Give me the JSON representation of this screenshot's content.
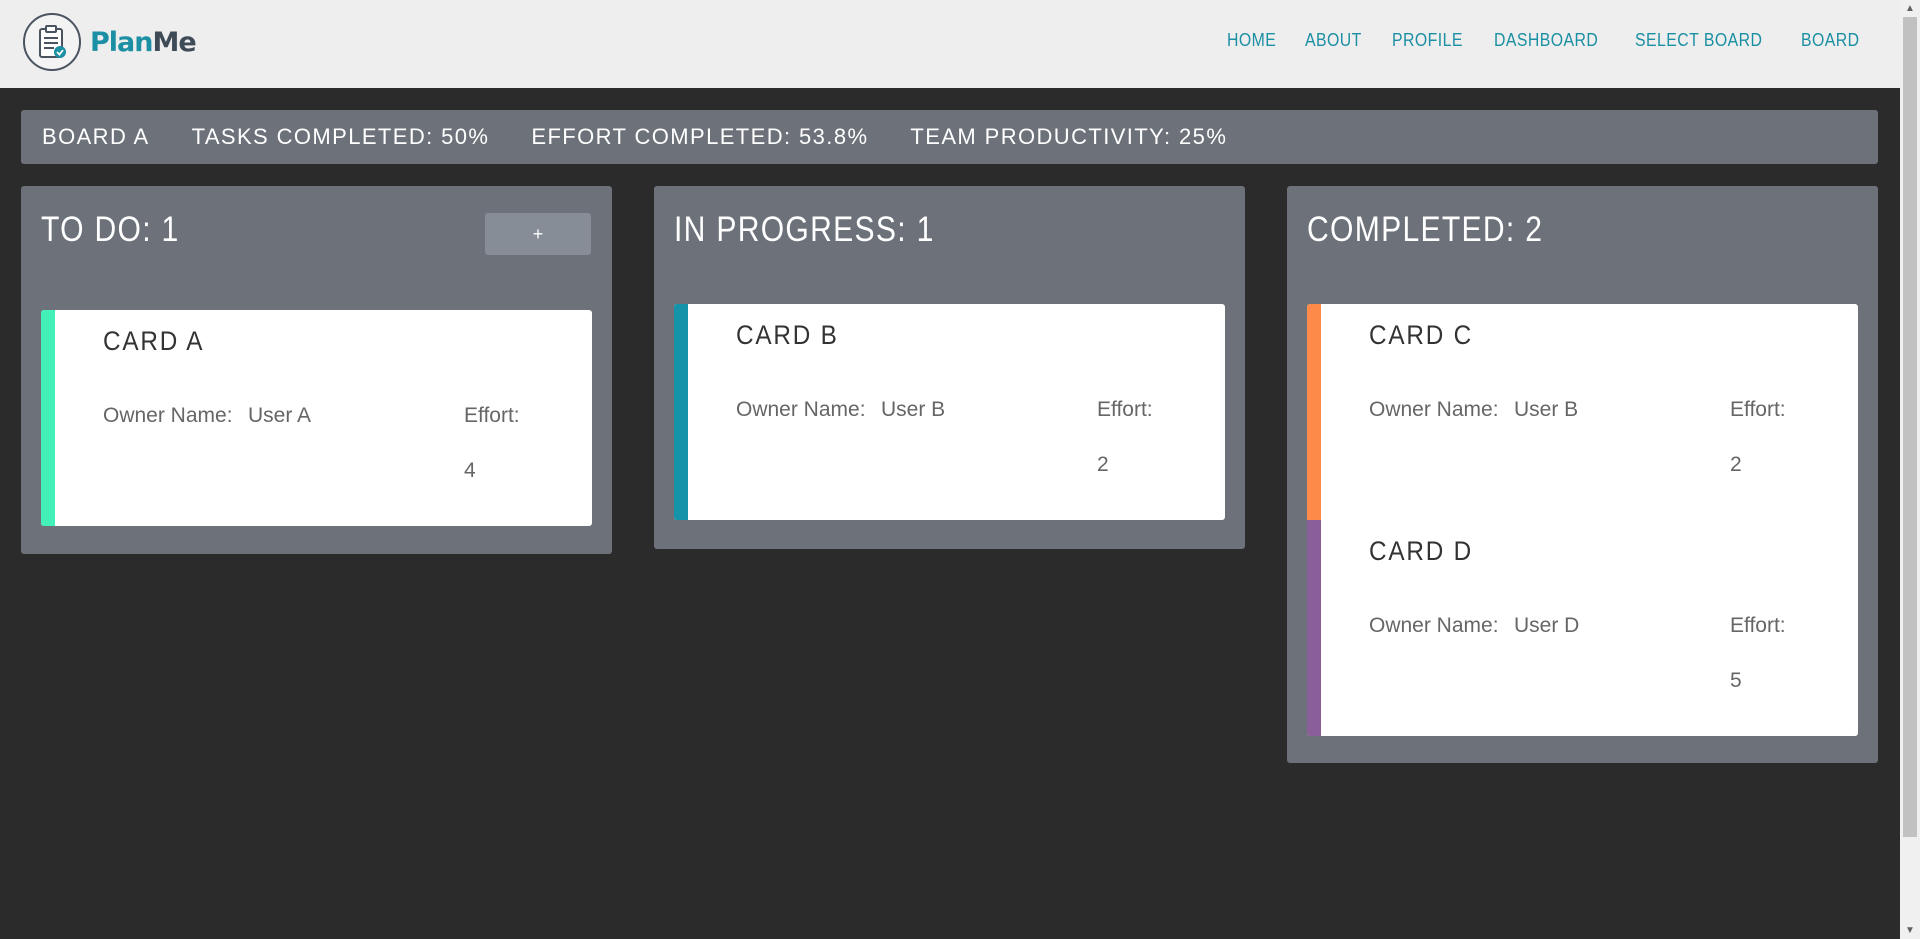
{
  "header": {
    "logo_text_1": "Plan",
    "logo_text_2": "Me",
    "nav": [
      "HOME",
      "ABOUT",
      "PROFILE",
      "DASHBOARD",
      "SELECT BOARD",
      "BOARD"
    ]
  },
  "stats": {
    "board": "BOARD A",
    "tasks_completed": "TASKS COMPLETED: 50%",
    "effort_completed": "EFFORT COMPLETED: 53.8%",
    "team_productivity": "TEAM PRODUCTIVITY: 25%"
  },
  "columns": [
    {
      "title": "TO DO: 1",
      "add_label": "+",
      "cards": [
        {
          "title": "CARD A",
          "owner_label": "Owner Name:",
          "owner": "User A",
          "effort_label": "Effort:",
          "effort": "4",
          "color": "#42f0b8"
        }
      ]
    },
    {
      "title": "IN PROGRESS: 1",
      "cards": [
        {
          "title": "CARD B",
          "owner_label": "Owner Name:",
          "owner": "User B",
          "effort_label": "Effort:",
          "effort": "2",
          "color": "#1593a8"
        }
      ]
    },
    {
      "title": "COMPLETED: 2",
      "cards": [
        {
          "title": "CARD C",
          "owner_label": "Owner Name:",
          "owner": "User B",
          "effort_label": "Effort:",
          "effort": "2",
          "color": "#fd8a48"
        },
        {
          "title": "CARD D",
          "owner_label": "Owner Name:",
          "owner": "User D",
          "effort_label": "Effort:",
          "effort": "5",
          "color": "#8a5f99"
        }
      ]
    }
  ]
}
